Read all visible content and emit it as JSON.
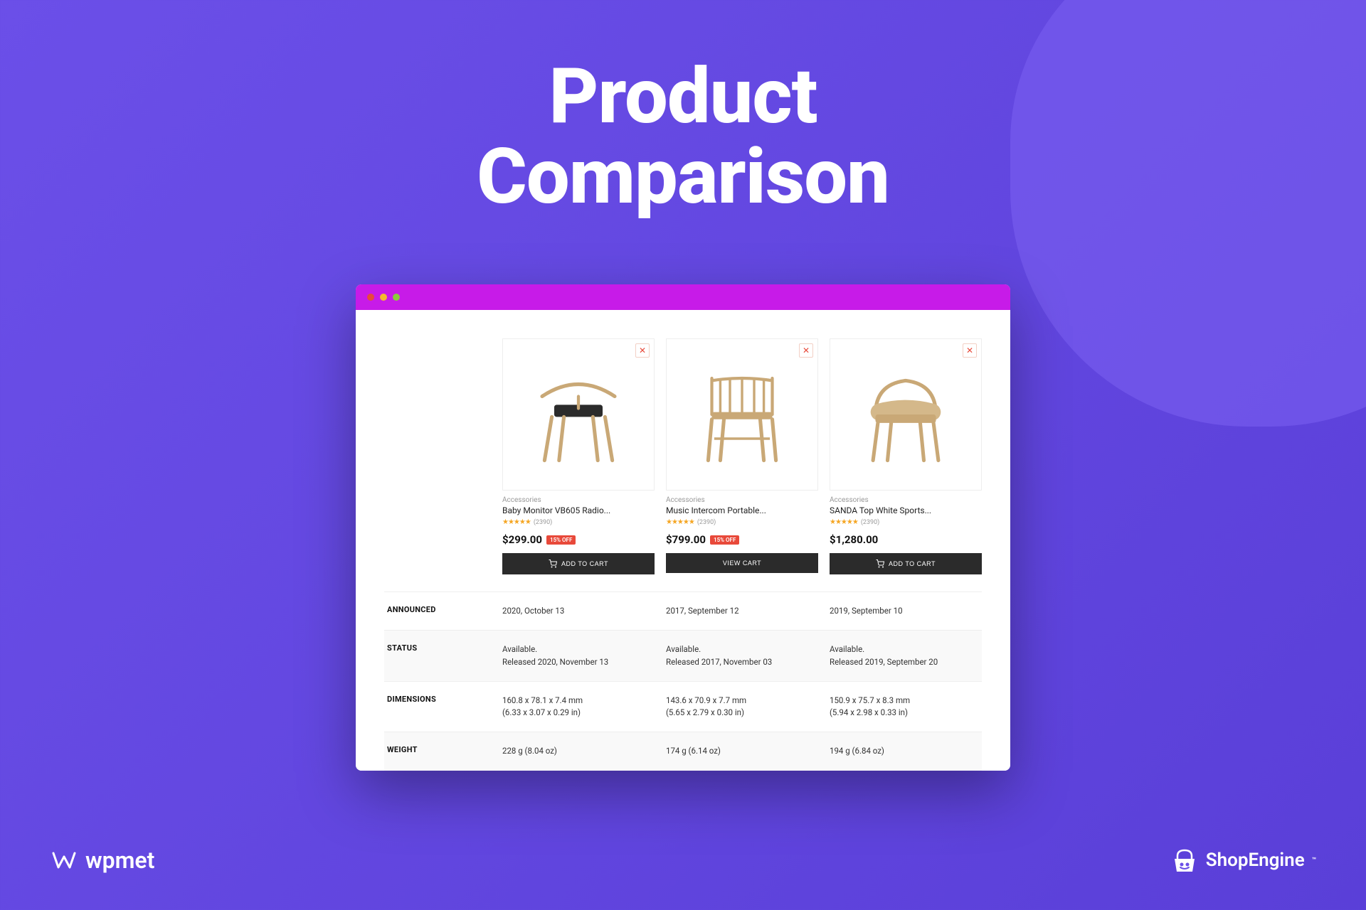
{
  "hero": {
    "line1": "Product",
    "line2": "Comparison"
  },
  "products": [
    {
      "category": "Accessories",
      "name": "Baby Monitor VB605 Radio...",
      "rating_count": "(2390)",
      "price": "$299.00",
      "discount": "15% OFF",
      "button": "ADD TO CART",
      "button_has_icon": true
    },
    {
      "category": "Accessories",
      "name": "Music Intercom Portable...",
      "rating_count": "(2390)",
      "price": "$799.00",
      "discount": "15% OFF",
      "button": "VIEW CART",
      "button_has_icon": false
    },
    {
      "category": "Accessories",
      "name": "SANDA Top White Sports...",
      "rating_count": "(2390)",
      "price": "$1,280.00",
      "discount": "",
      "button": "ADD TO CART",
      "button_has_icon": true
    }
  ],
  "specs": [
    {
      "label": "ANNOUNCED",
      "values": [
        "2020, October 13",
        "2017, September 12",
        "2019, September 10"
      ]
    },
    {
      "label": "STATUS",
      "values": [
        "Available.\nReleased 2020, November 13",
        "Available.\nReleased 2017, November 03",
        "Available.\nReleased 2019, September 20"
      ]
    },
    {
      "label": "DIMENSIONS",
      "values": [
        "160.8 x 78.1 x 7.4 mm\n(6.33 x 3.07 x 0.29 in)",
        "143.6 x 70.9 x 7.7 mm\n(5.65 x 2.79 x 0.30 in)",
        "150.9 x 75.7 x 8.3 mm\n(5.94 x 2.98 x 0.33 in)"
      ]
    },
    {
      "label": "WEIGHT",
      "values": [
        "228 g (8.04 oz)",
        "174 g (6.14 oz)",
        "194 g (6.84 oz)"
      ]
    }
  ],
  "footer": {
    "left": "wpmet",
    "right": "ShopEngine"
  }
}
